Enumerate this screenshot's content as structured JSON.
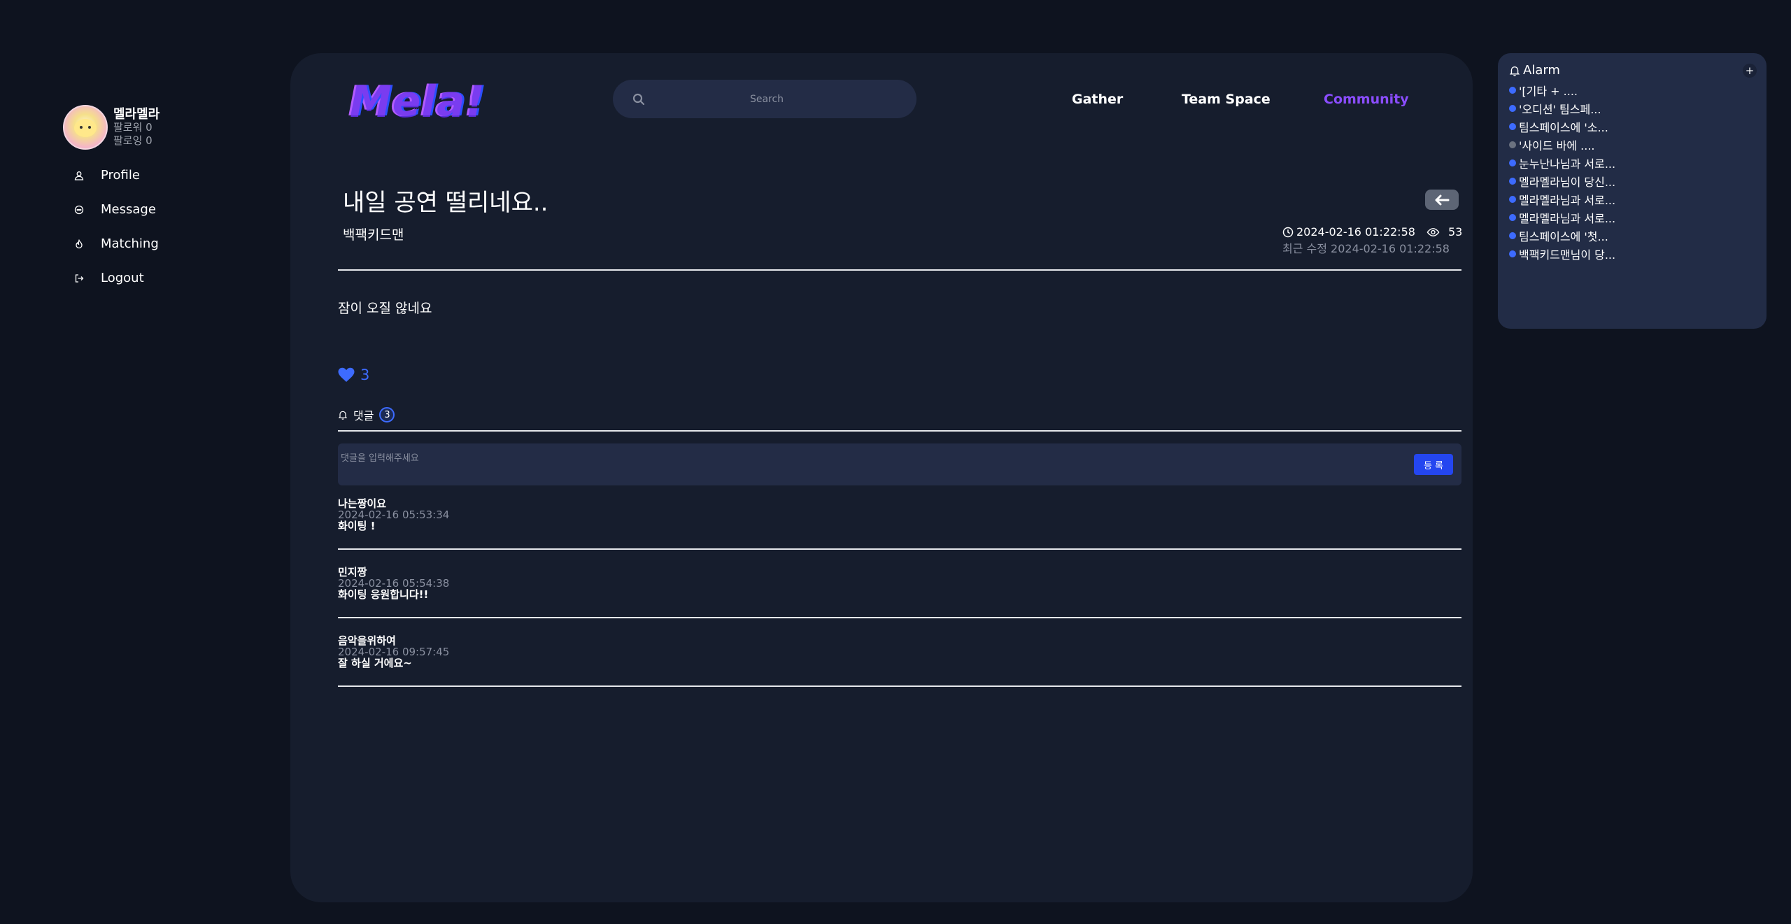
{
  "sidebar": {
    "username": "멜라멜라",
    "followers": "팔로워 0",
    "following": "팔로잉 0",
    "menu": [
      {
        "label": "Profile",
        "icon": "user-icon"
      },
      {
        "label": "Message",
        "icon": "message-icon"
      },
      {
        "label": "Matching",
        "icon": "fire-icon"
      },
      {
        "label": "Logout",
        "icon": "logout-icon"
      }
    ]
  },
  "header": {
    "logo": "Mela!",
    "search_placeholder": "Search",
    "nav": [
      {
        "label": "Gather",
        "active": false
      },
      {
        "label": "Team Space",
        "active": false
      },
      {
        "label": "Community",
        "active": true
      }
    ]
  },
  "post": {
    "title": "내일 공연 떨리네요..",
    "author": "백팩키드맨",
    "created_at": "2024-02-16 01:22:58",
    "views": "53",
    "edited": "최근 수정 2024-02-16 01:22:58",
    "content": "잠이 오질 않네요",
    "likes": "3"
  },
  "comments": {
    "label": "댓글",
    "count": "3",
    "placeholder": "댓글을 입력해주세요",
    "submit_label": "등 록",
    "items": [
      {
        "author": "나는짱이요",
        "date": "2024-02-16 05:53:34",
        "text": "화이팅 !"
      },
      {
        "author": "민지짱",
        "date": "2024-02-16 05:54:38",
        "text": "화이팅 응원합니다!!"
      },
      {
        "author": "음악을위하여",
        "date": "2024-02-16 09:57:45",
        "text": "잘 하실 거에요~"
      }
    ]
  },
  "alarm": {
    "title": "Alarm",
    "add_label": "+",
    "items": [
      {
        "text": "'[기타 + ....",
        "read": false
      },
      {
        "text": "'오디션' 팀스페...",
        "read": false
      },
      {
        "text": "팀스페이스에 '소...",
        "read": false
      },
      {
        "text": "'사이드 바에 ....",
        "read": true
      },
      {
        "text": "눈누난나님과 서로...",
        "read": false
      },
      {
        "text": "멜라멜라님이 당신...",
        "read": false
      },
      {
        "text": "멜라멜라님과 서로...",
        "read": false
      },
      {
        "text": "멜라멜라님과 서로...",
        "read": false
      },
      {
        "text": "팀스페이스에 '첫...",
        "read": false
      },
      {
        "text": "백팩키드맨님이 당...",
        "read": false
      }
    ]
  },
  "colors": {
    "page_bg": "#0e131f",
    "panel_bg": "#161d2d",
    "accent_blue": "#3d6bff",
    "nav_active": "#8b4dff",
    "unread_dot": "#3d6bff",
    "read_dot": "#6b7280"
  }
}
